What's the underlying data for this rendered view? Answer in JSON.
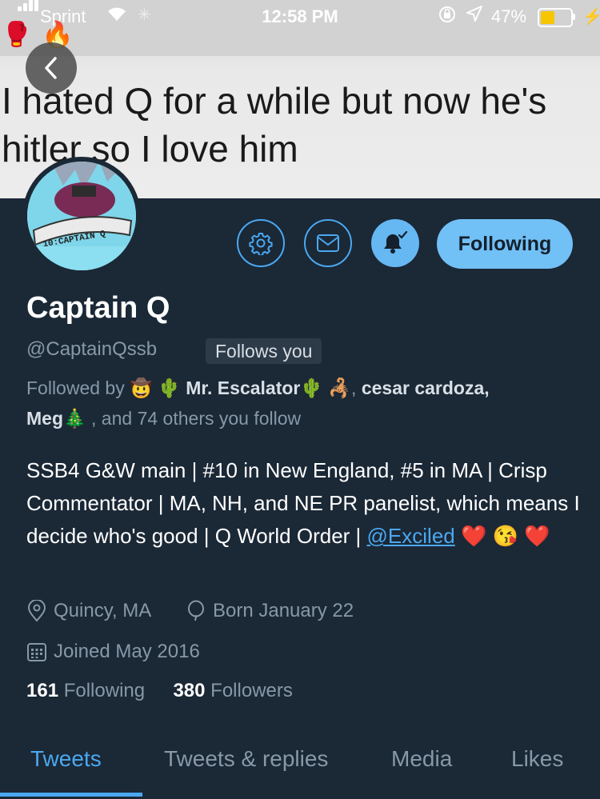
{
  "status_bar": {
    "carrier": "Sprint",
    "time": "12:58 PM",
    "battery_percent": "47%",
    "battery_level": 0.47,
    "battery_color": "#f7c600"
  },
  "banner": {
    "text": "I hated Q for a while but now he's\nhitler so I love him"
  },
  "avatar_text": "10:CAPTAIN Q",
  "profile": {
    "name": "Captain Q",
    "handle": "@CaptainQssb",
    "follows_you_badge": "Follows you",
    "followed_by_prefix": "Followed by",
    "followed_by_emoji_1": "🤠 🌵",
    "followed_by_name_1": "Mr. Escalator",
    "followed_by_emoji_2": "🌵 🦂",
    "followed_by_sep": ",",
    "followed_by_name_2": "cesar cardoza,",
    "followed_by_name_3": "Meg",
    "followed_by_emoji_3": "🎄",
    "followed_by_suffix": ", and 74 others you follow",
    "bio": "SSB4 G&W main | #10 in New England, #5 in MA | Crisp Commentator | MA, NH, and NE PR panelist, which means I decide who's good | Q World Order | ",
    "bio_mention": "@Exciled",
    "bio_emoji": "❤️ 😘 ❤️",
    "location": "Quincy, MA",
    "birthday": "Born January 22",
    "joined": "Joined May 2016",
    "following_count": "161",
    "following_label": "Following",
    "followers_count": "380",
    "followers_label": "Followers"
  },
  "actions": {
    "settings_icon": "gear-icon",
    "message_icon": "envelope-icon",
    "notifications_icon": "bell-check-icon",
    "following_button": "Following"
  },
  "tabs": [
    {
      "label": "Tweets",
      "active": true
    },
    {
      "label": "Tweets & replies",
      "active": false
    },
    {
      "label": "Media",
      "active": false
    },
    {
      "label": "Likes",
      "active": false
    }
  ],
  "colors": {
    "background": "#1b2836",
    "accent": "#4aa8f0",
    "secondary_text": "#8899a6"
  }
}
